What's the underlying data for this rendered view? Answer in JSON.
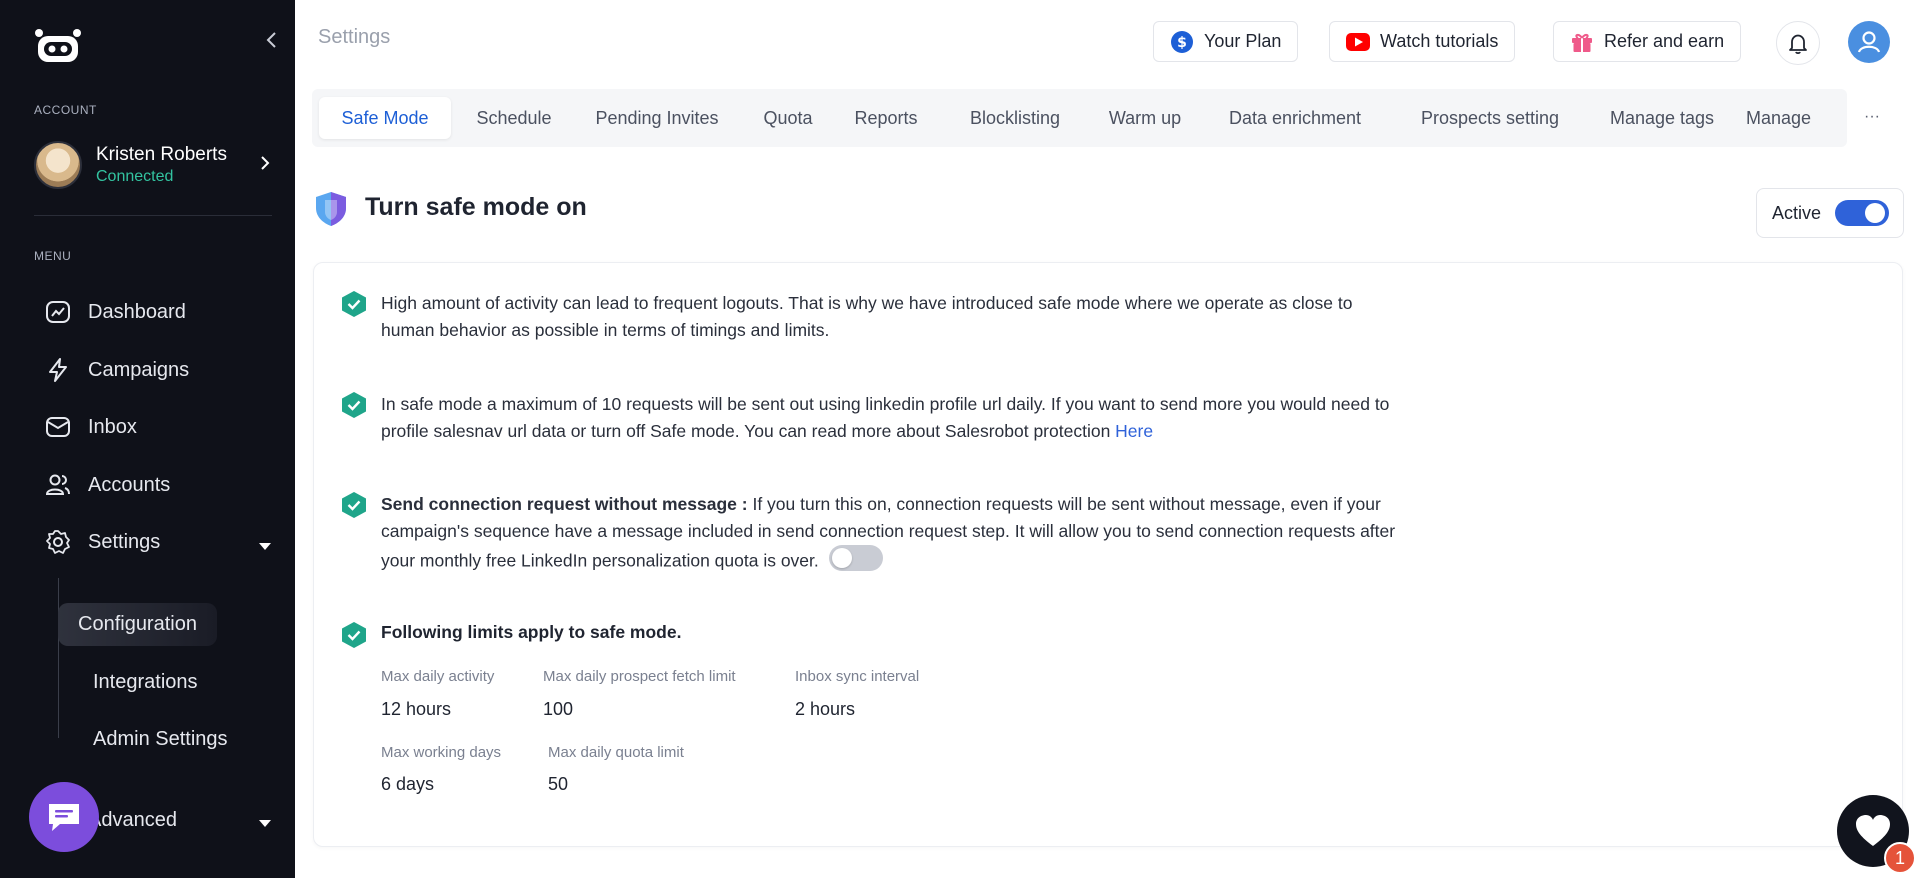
{
  "sidebar": {
    "account_label": "ACCOUNT",
    "account_name": "Kristen Roberts",
    "account_status": "Connected",
    "menu_label": "MENU",
    "items": [
      {
        "label": "Dashboard",
        "icon": "dashboard-icon"
      },
      {
        "label": "Campaigns",
        "icon": "lightning-icon"
      },
      {
        "label": "Inbox",
        "icon": "inbox-icon"
      },
      {
        "label": "Accounts",
        "icon": "users-icon"
      },
      {
        "label": "Settings",
        "icon": "gear-icon"
      }
    ],
    "sub_items": [
      {
        "label": "Configuration",
        "active": true
      },
      {
        "label": "Integrations"
      },
      {
        "label": "Admin Settings"
      }
    ],
    "advanced_label": "Advanced"
  },
  "header": {
    "title": "Settings",
    "your_plan": "Your Plan",
    "watch_tutorials": "Watch tutorials",
    "refer_earn": "Refer and earn"
  },
  "tabs": [
    "Safe Mode",
    "Schedule",
    "Pending Invites",
    "Quota",
    "Reports",
    "Blocklisting",
    "Warm up",
    "Data enrichment",
    "Prospects setting",
    "Manage tags",
    "Manage"
  ],
  "section": {
    "title": "Turn safe mode on",
    "active_label": "Active",
    "active": true
  },
  "paragraphs": {
    "p1": "High amount of activity can lead to frequent logouts. That is why we have introduced safe mode where we operate as close to human behavior as possible in terms of timings and limits.",
    "p2": "In safe mode a maximum of 10 requests will be sent out using linkedin profile url daily. If you want to send more you would need to profile salesnav url data or turn off Safe mode. You can read more about Salesrobot protection ",
    "p2_link": "Here",
    "p3_bold": "Send connection request without message :",
    "p3": " If you turn this on, connection requests will be sent without message, even if your campaign's sequence have a message included in send connection request step. It will allow you to send connection requests after your monthly free LinkedIn personalization quota is over.",
    "p3_toggle_on": false
  },
  "limits": {
    "title": "Following limits apply to safe mode.",
    "items": [
      {
        "label": "Max daily activity",
        "value": "12 hours"
      },
      {
        "label": "Max daily prospect fetch limit",
        "value": "100"
      },
      {
        "label": "Inbox sync interval",
        "value": "2 hours"
      },
      {
        "label": "Max working days",
        "value": "6 days"
      },
      {
        "label": "Max daily quota limit",
        "value": "50"
      }
    ]
  },
  "support": {
    "badge": "1"
  },
  "colors": {
    "accent": "#2f62d9",
    "sidebar_bg": "#0f1119",
    "success": "#1fa58a",
    "chat_fab": "#7c4ddc"
  }
}
